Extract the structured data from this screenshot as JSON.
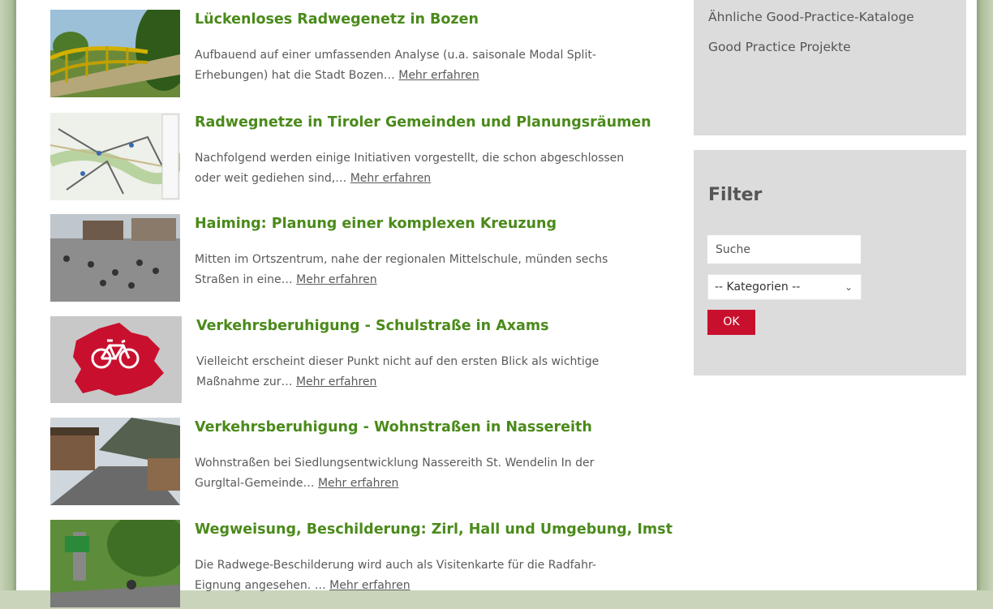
{
  "entries": [
    {
      "title": "Lückenloses Radwegenetz in Bozen",
      "text": "Aufbauend auf einer umfassenden Analyse (u.a. saisonale Modal Split-Erhebungen) hat die Stadt Bozen…",
      "more": "Mehr erfahren"
    },
    {
      "title": "Radwegnetze in Tiroler Gemeinden und Planungsräumen",
      "text": "Nachfolgend werden einige Initiativen vorgestellt, die schon abgeschlossen oder weit gediehen sind,…",
      "more": "Mehr erfahren"
    },
    {
      "title": "Haiming: Planung einer komplexen Kreuzung",
      "text": "Mitten im Ortszentrum, nahe der regionalen Mittelschule, münden sechs Straßen in eine…",
      "more": "Mehr erfahren"
    },
    {
      "title": "Verkehrsberuhigung - Schulstraße in Axams",
      "text": "Vielleicht erscheint dieser Punkt nicht auf den ersten Blick als wichtige Maßnahme zur…",
      "more": "Mehr erfahren"
    },
    {
      "title": "Verkehrsberuhigung - Wohnstraßen in Nassereith",
      "text": "Wohnstraßen bei Siedlungsentwicklung Nassereith St. Wendelin In der Gurgltal-Gemeinde…",
      "more": "Mehr erfahren"
    },
    {
      "title": "Wegweisung, Beschilderung: Zirl, Hall und Umgebung, Imst",
      "text": "Die Radwege-Beschilderung wird auch als Visitenkarte für die Radfahr-Eignung angesehen. …",
      "more": "Mehr erfahren"
    }
  ],
  "sidebar": {
    "links": [
      "Ähnliche Good-Practice-Kataloge",
      "Good Practice Projekte"
    ]
  },
  "filter": {
    "title": "Filter",
    "search_placeholder": "Suche",
    "category_selected": "-- Kategorien --",
    "ok_label": "OK"
  },
  "colors": {
    "title_green": "#4a8a1a",
    "ok_red": "#c8102e",
    "sidebar_gray": "#dcdcdc"
  }
}
